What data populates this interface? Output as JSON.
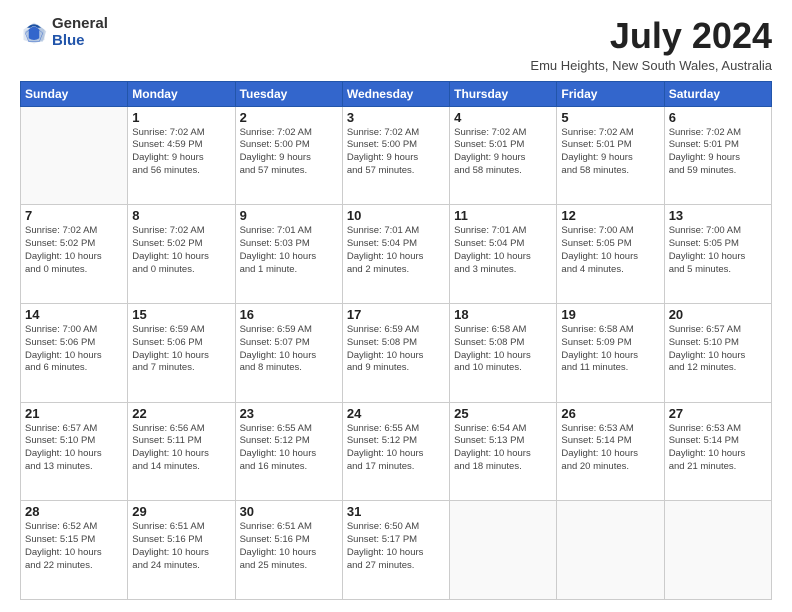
{
  "header": {
    "logo_general": "General",
    "logo_blue": "Blue",
    "month_title": "July 2024",
    "location": "Emu Heights, New South Wales, Australia"
  },
  "weekdays": [
    "Sunday",
    "Monday",
    "Tuesday",
    "Wednesday",
    "Thursday",
    "Friday",
    "Saturday"
  ],
  "weeks": [
    [
      {
        "day": "",
        "info": ""
      },
      {
        "day": "1",
        "info": "Sunrise: 7:02 AM\nSunset: 4:59 PM\nDaylight: 9 hours\nand 56 minutes."
      },
      {
        "day": "2",
        "info": "Sunrise: 7:02 AM\nSunset: 5:00 PM\nDaylight: 9 hours\nand 57 minutes."
      },
      {
        "day": "3",
        "info": "Sunrise: 7:02 AM\nSunset: 5:00 PM\nDaylight: 9 hours\nand 57 minutes."
      },
      {
        "day": "4",
        "info": "Sunrise: 7:02 AM\nSunset: 5:01 PM\nDaylight: 9 hours\nand 58 minutes."
      },
      {
        "day": "5",
        "info": "Sunrise: 7:02 AM\nSunset: 5:01 PM\nDaylight: 9 hours\nand 58 minutes."
      },
      {
        "day": "6",
        "info": "Sunrise: 7:02 AM\nSunset: 5:01 PM\nDaylight: 9 hours\nand 59 minutes."
      }
    ],
    [
      {
        "day": "7",
        "info": "Sunrise: 7:02 AM\nSunset: 5:02 PM\nDaylight: 10 hours\nand 0 minutes."
      },
      {
        "day": "8",
        "info": "Sunrise: 7:02 AM\nSunset: 5:02 PM\nDaylight: 10 hours\nand 0 minutes."
      },
      {
        "day": "9",
        "info": "Sunrise: 7:01 AM\nSunset: 5:03 PM\nDaylight: 10 hours\nand 1 minute."
      },
      {
        "day": "10",
        "info": "Sunrise: 7:01 AM\nSunset: 5:04 PM\nDaylight: 10 hours\nand 2 minutes."
      },
      {
        "day": "11",
        "info": "Sunrise: 7:01 AM\nSunset: 5:04 PM\nDaylight: 10 hours\nand 3 minutes."
      },
      {
        "day": "12",
        "info": "Sunrise: 7:00 AM\nSunset: 5:05 PM\nDaylight: 10 hours\nand 4 minutes."
      },
      {
        "day": "13",
        "info": "Sunrise: 7:00 AM\nSunset: 5:05 PM\nDaylight: 10 hours\nand 5 minutes."
      }
    ],
    [
      {
        "day": "14",
        "info": "Sunrise: 7:00 AM\nSunset: 5:06 PM\nDaylight: 10 hours\nand 6 minutes."
      },
      {
        "day": "15",
        "info": "Sunrise: 6:59 AM\nSunset: 5:06 PM\nDaylight: 10 hours\nand 7 minutes."
      },
      {
        "day": "16",
        "info": "Sunrise: 6:59 AM\nSunset: 5:07 PM\nDaylight: 10 hours\nand 8 minutes."
      },
      {
        "day": "17",
        "info": "Sunrise: 6:59 AM\nSunset: 5:08 PM\nDaylight: 10 hours\nand 9 minutes."
      },
      {
        "day": "18",
        "info": "Sunrise: 6:58 AM\nSunset: 5:08 PM\nDaylight: 10 hours\nand 10 minutes."
      },
      {
        "day": "19",
        "info": "Sunrise: 6:58 AM\nSunset: 5:09 PM\nDaylight: 10 hours\nand 11 minutes."
      },
      {
        "day": "20",
        "info": "Sunrise: 6:57 AM\nSunset: 5:10 PM\nDaylight: 10 hours\nand 12 minutes."
      }
    ],
    [
      {
        "day": "21",
        "info": "Sunrise: 6:57 AM\nSunset: 5:10 PM\nDaylight: 10 hours\nand 13 minutes."
      },
      {
        "day": "22",
        "info": "Sunrise: 6:56 AM\nSunset: 5:11 PM\nDaylight: 10 hours\nand 14 minutes."
      },
      {
        "day": "23",
        "info": "Sunrise: 6:55 AM\nSunset: 5:12 PM\nDaylight: 10 hours\nand 16 minutes."
      },
      {
        "day": "24",
        "info": "Sunrise: 6:55 AM\nSunset: 5:12 PM\nDaylight: 10 hours\nand 17 minutes."
      },
      {
        "day": "25",
        "info": "Sunrise: 6:54 AM\nSunset: 5:13 PM\nDaylight: 10 hours\nand 18 minutes."
      },
      {
        "day": "26",
        "info": "Sunrise: 6:53 AM\nSunset: 5:14 PM\nDaylight: 10 hours\nand 20 minutes."
      },
      {
        "day": "27",
        "info": "Sunrise: 6:53 AM\nSunset: 5:14 PM\nDaylight: 10 hours\nand 21 minutes."
      }
    ],
    [
      {
        "day": "28",
        "info": "Sunrise: 6:52 AM\nSunset: 5:15 PM\nDaylight: 10 hours\nand 22 minutes."
      },
      {
        "day": "29",
        "info": "Sunrise: 6:51 AM\nSunset: 5:16 PM\nDaylight: 10 hours\nand 24 minutes."
      },
      {
        "day": "30",
        "info": "Sunrise: 6:51 AM\nSunset: 5:16 PM\nDaylight: 10 hours\nand 25 minutes."
      },
      {
        "day": "31",
        "info": "Sunrise: 6:50 AM\nSunset: 5:17 PM\nDaylight: 10 hours\nand 27 minutes."
      },
      {
        "day": "",
        "info": ""
      },
      {
        "day": "",
        "info": ""
      },
      {
        "day": "",
        "info": ""
      }
    ]
  ]
}
